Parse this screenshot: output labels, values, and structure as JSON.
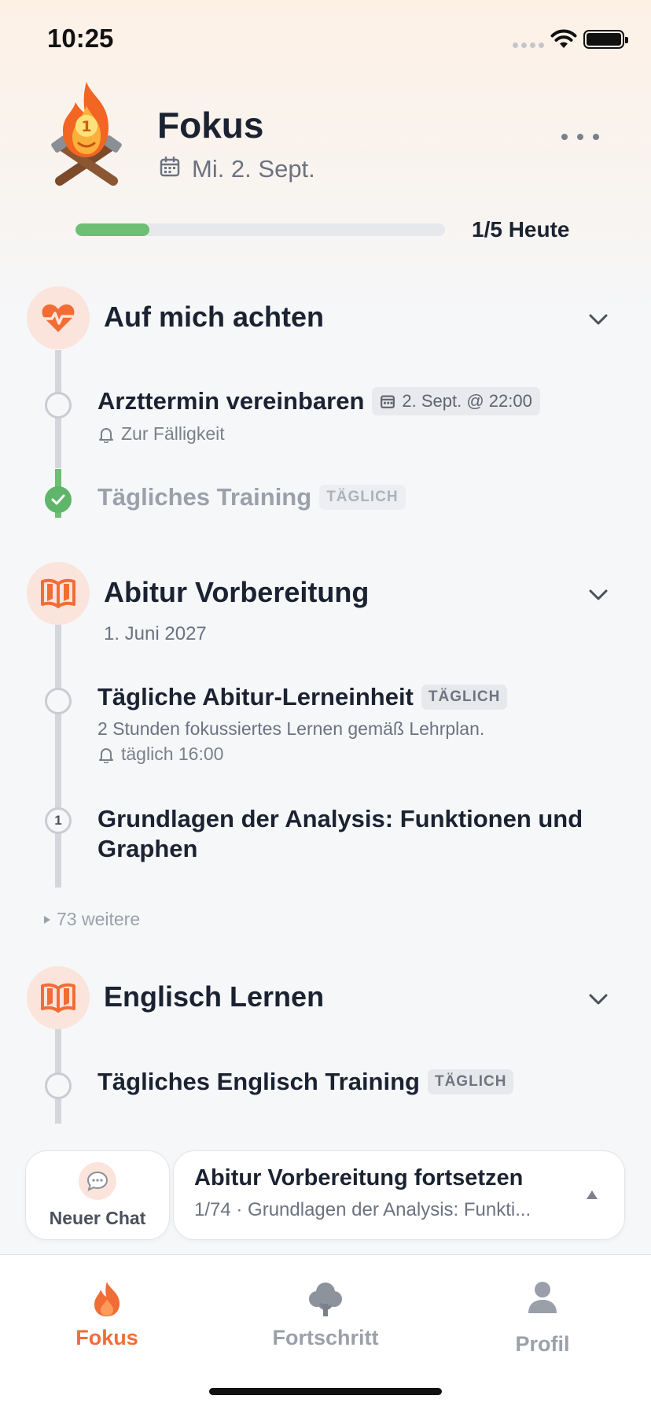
{
  "status_bar": {
    "time": "10:25"
  },
  "header": {
    "title": "Fokus",
    "date": "Mi. 2. Sept.",
    "progress_fraction": 0.2,
    "progress_label": "1/5 Heute"
  },
  "groups": [
    {
      "title": "Auf mich achten",
      "icon": "heart-pulse-icon",
      "tasks": [
        {
          "title": "Arzttermin vereinbaren",
          "due": "2. Sept. @ 22:00",
          "reminder": "Zur Fälligkeit",
          "done": false
        },
        {
          "title": "Tägliches Training",
          "badge": "TÄGLICH",
          "done": true
        }
      ]
    },
    {
      "title": "Abitur Vorbereitung",
      "icon": "open-book-icon",
      "subtitle": "1. Juni 2027",
      "tasks": [
        {
          "title": "Tägliche Abitur-Lerneinheit",
          "badge": "TÄGLICH",
          "description": "2 Stunden fokussiertes Lernen gemäß Lehrplan.",
          "reminder": "täglich 16:00",
          "done": false
        },
        {
          "number": "1",
          "title_line1": "Grundlagen der Analysis: Funktionen und",
          "title_line2": "Graphen"
        }
      ],
      "more_label": "73 weitere"
    },
    {
      "title": "Englisch Lernen",
      "icon": "open-book-icon",
      "tasks": [
        {
          "title": "Tägliches Englisch Training",
          "badge": "TÄGLICH",
          "done": false
        }
      ]
    }
  ],
  "actions": {
    "new_chat_label": "Neuer Chat",
    "continue_title": "Abitur Vorbereitung fortsetzen",
    "continue_subtitle": "1/74 · Grundlagen der Analysis: Funkti..."
  },
  "tabbar": {
    "tabs": [
      {
        "label": "Fokus",
        "icon": "flame-icon",
        "active": true
      },
      {
        "label": "Fortschritt",
        "icon": "tree-icon",
        "active": false
      },
      {
        "label": "Profil",
        "icon": "person-icon",
        "active": false
      }
    ]
  },
  "colors": {
    "accent": "#f26d36",
    "progress": "#6cbf73",
    "icon_bg": "#fbe4dc"
  }
}
